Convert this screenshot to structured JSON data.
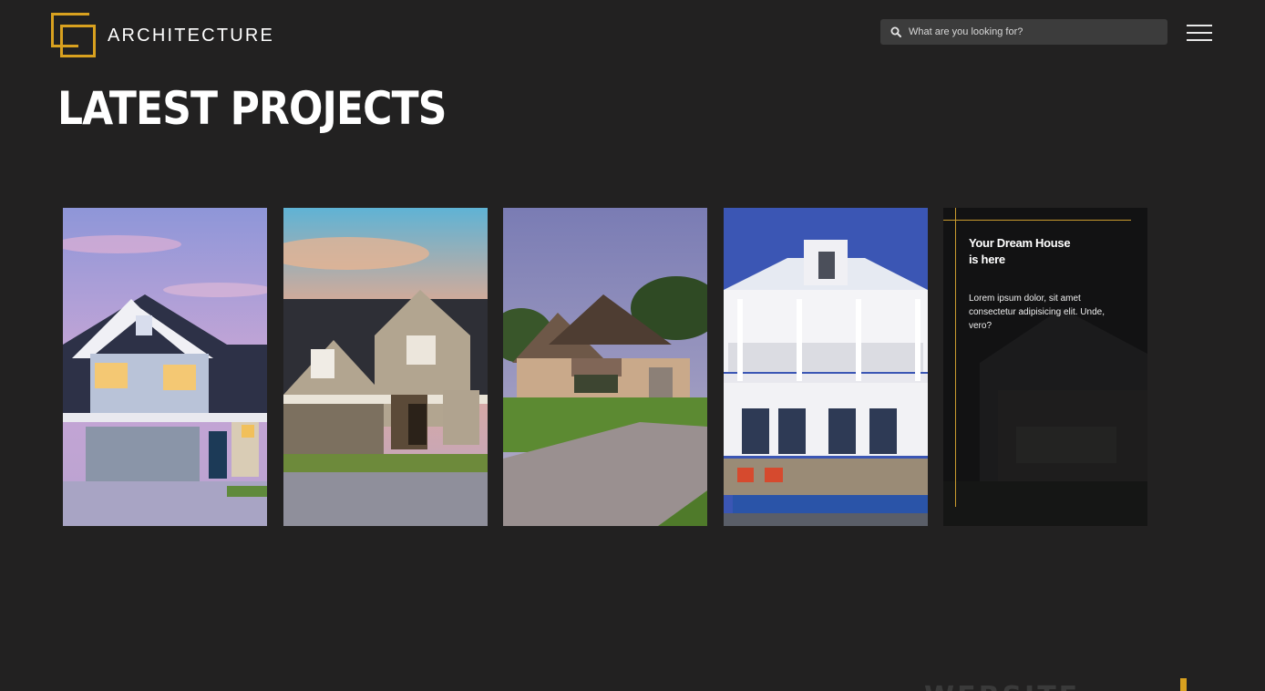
{
  "brand": {
    "name": "ARCHITECTURE",
    "accent": "#d9a11f"
  },
  "search": {
    "placeholder": "What are you looking for?",
    "icon": "search-icon"
  },
  "menu": {
    "icon": "hamburger-menu-icon"
  },
  "main": {
    "title": "LATEST PROJECTS",
    "projects": [
      {
        "image": "blue-suburban-house-at-dusk"
      },
      {
        "image": "beige-craftsman-house-at-sunset"
      },
      {
        "image": "stone-cottage-with-driveway"
      },
      {
        "image": "white-colonial-house-with-pool"
      }
    ],
    "promo": {
      "heading_line1": "Your Dream House",
      "heading_line2": "is here",
      "body": "Lorem ipsum dolor, sit amet consectetur adipisicing elit. Unde, vero?"
    }
  },
  "footer": {
    "partial_text": "WEBSITE"
  }
}
